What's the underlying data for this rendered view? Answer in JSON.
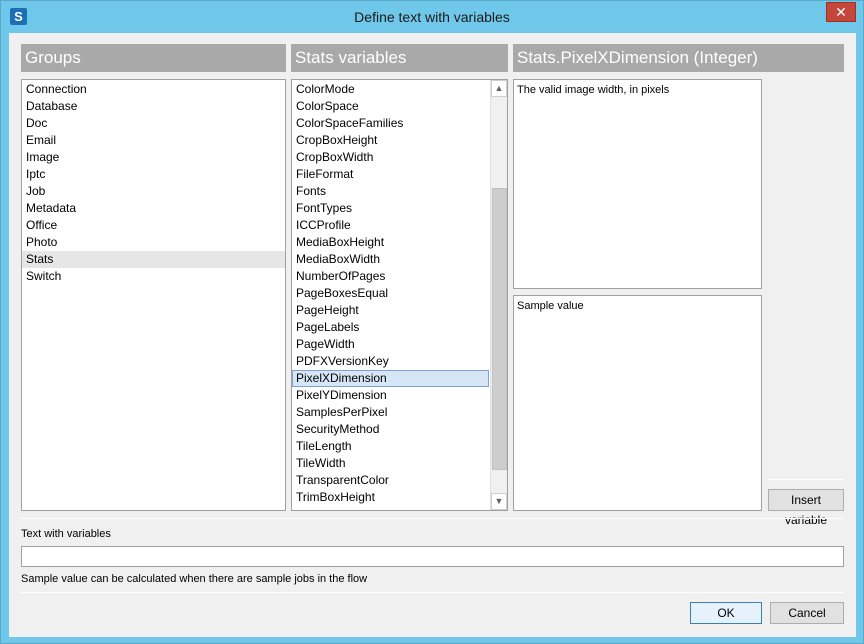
{
  "window": {
    "app_icon_letter": "S",
    "title": "Define text with variables",
    "close_symbol": "✕"
  },
  "groups": {
    "header": "Groups",
    "items": [
      "Connection",
      "Database",
      "Doc",
      "Email",
      "Image",
      "Iptc",
      "Job",
      "Metadata",
      "Office",
      "Photo",
      "Stats",
      "Switch"
    ],
    "selected": "Stats"
  },
  "stats_variables": {
    "header": "Stats variables",
    "items": [
      "ColorMode",
      "ColorSpace",
      "ColorSpaceFamilies",
      "CropBoxHeight",
      "CropBoxWidth",
      "FileFormat",
      "Fonts",
      "FontTypes",
      "ICCProfile",
      "MediaBoxHeight",
      "MediaBoxWidth",
      "NumberOfPages",
      "PageBoxesEqual",
      "PageHeight",
      "PageLabels",
      "PageWidth",
      "PDFXVersionKey",
      "PixelXDimension",
      "PixelYDimension",
      "SamplesPerPixel",
      "SecurityMethod",
      "TileLength",
      "TileWidth",
      "TransparentColor",
      "TrimBoxHeight"
    ],
    "selected": "PixelXDimension",
    "scroll_up_icon": "▲",
    "scroll_down_icon": "▼"
  },
  "details": {
    "header": "Stats.PixelXDimension (Integer)",
    "description": "The valid image width, in pixels",
    "sample_value": "Sample value",
    "insert_button": "Insert variable"
  },
  "text_with_variables": {
    "label": "Text with variables",
    "value": "",
    "note": "Sample value can be calculated when there are sample jobs in the flow"
  },
  "buttons": {
    "ok": "OK",
    "cancel": "Cancel"
  }
}
